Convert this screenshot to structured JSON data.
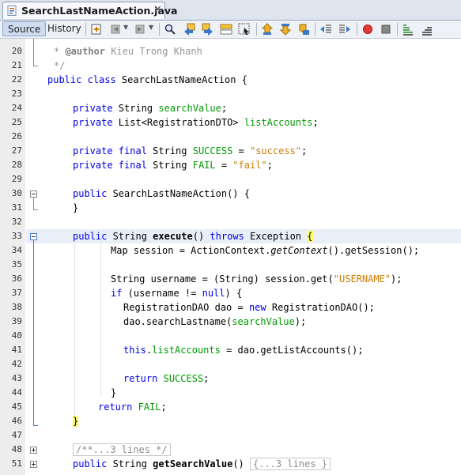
{
  "tab": {
    "title": "SearchLastNameAction.java",
    "close": "✕",
    "icon": "java-file-icon"
  },
  "toolbar": {
    "source": "Source",
    "history": "History"
  },
  "line_numbers": [
    "20",
    "21",
    "22",
    "23",
    "24",
    "25",
    "26",
    "27",
    "28",
    "29",
    "30",
    "31",
    "32",
    "33",
    "34",
    "35",
    "36",
    "37",
    "38",
    "39",
    "40",
    "41",
    "42",
    "43",
    "44",
    "45",
    "46",
    "47",
    "48",
    "51"
  ],
  "code": {
    "l20": [
      "* ",
      "@author",
      " Kieu Trong Khanh"
    ],
    "l21": "*/",
    "l22": [
      "public class",
      " SearchLastNameAction {"
    ],
    "l24": [
      "private",
      " String ",
      "searchValue",
      ";"
    ],
    "l25": [
      "private",
      " List<RegistrationDTO> ",
      "listAccounts",
      ";"
    ],
    "l27": [
      "private final",
      " String ",
      "SUCCESS",
      " = ",
      "\"success\"",
      ";"
    ],
    "l28": [
      "private final",
      " String ",
      "FAIL",
      " = ",
      "\"fail\"",
      ";"
    ],
    "l30": [
      "public",
      " SearchLastNameAction() {"
    ],
    "l31": "}",
    "l33": [
      "public",
      " String ",
      "execute",
      "() ",
      "throws",
      " Exception ",
      "{"
    ],
    "l34": [
      "Map session = ActionContext.",
      "getContext",
      "().getSession();"
    ],
    "l36": [
      "String username = (String) session.get(",
      "\"USERNAME\"",
      ");"
    ],
    "l37": [
      "if",
      " (username != ",
      "null",
      ") {"
    ],
    "l38": [
      "RegistrationDAO dao = ",
      "new",
      " RegistrationDAO();"
    ],
    "l39": [
      "dao.searchLastname(",
      "searchValue",
      ");"
    ],
    "l41": [
      "this",
      ".",
      "listAccounts",
      " = dao.getListAccounts();"
    ],
    "l43": [
      "return",
      " ",
      "SUCCESS",
      ";"
    ],
    "l44": "}",
    "l45": [
      "return",
      " ",
      "FAIL",
      ";"
    ],
    "l46": "}",
    "l48": "/**...3 lines */",
    "l51": [
      "public",
      " String ",
      "getSearchValue",
      "() ",
      "{...3 lines }"
    ]
  }
}
